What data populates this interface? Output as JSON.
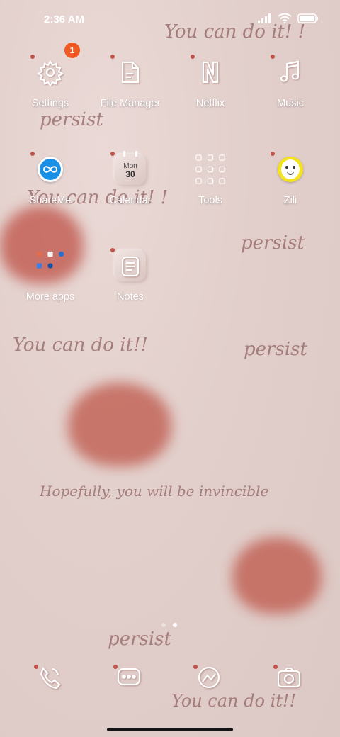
{
  "status_bar": {
    "time": "2:36 AM",
    "battery_icon": "battery-icon",
    "wifi_icon": "wifi-icon",
    "signal_icon": "signal-icon"
  },
  "wallpaper": {
    "texts": [
      "You can do it! !",
      "persist",
      "You can do it! !",
      "persist",
      "You can do it!!",
      "persist",
      "Hopefully, you will be invincible",
      "persist",
      "You can do it!!"
    ],
    "heart_color": "#c0574a"
  },
  "apps": [
    {
      "label": "Settings",
      "icon": "gear-icon",
      "badge": "1"
    },
    {
      "label": "File Manager",
      "icon": "folder-icon"
    },
    {
      "label": "Netflix",
      "icon": "netflix-icon"
    },
    {
      "label": "Music",
      "icon": "music-note-icon"
    },
    {
      "label": "ShareMe",
      "icon": "infinity-icon"
    },
    {
      "label": "Calendar",
      "icon": "calendar-icon",
      "month": "Mon",
      "day": "30"
    },
    {
      "label": "Tools",
      "icon": "tools-folder-icon"
    },
    {
      "label": "Zili",
      "icon": "zili-face-icon"
    },
    {
      "label": "More apps",
      "icon": "apps-folder-icon"
    },
    {
      "label": "Notes",
      "icon": "notes-icon"
    }
  ],
  "dock": [
    {
      "name": "phone",
      "icon": "phone-icon"
    },
    {
      "name": "messages",
      "icon": "messages-icon"
    },
    {
      "name": "browser",
      "icon": "browser-icon"
    },
    {
      "name": "camera",
      "icon": "camera-icon"
    }
  ],
  "page_indicator": {
    "pages": 2,
    "current": 2
  },
  "colors": {
    "accent_badge": "#f05a22",
    "dot": "#c0534a",
    "label": "#ffffff"
  }
}
